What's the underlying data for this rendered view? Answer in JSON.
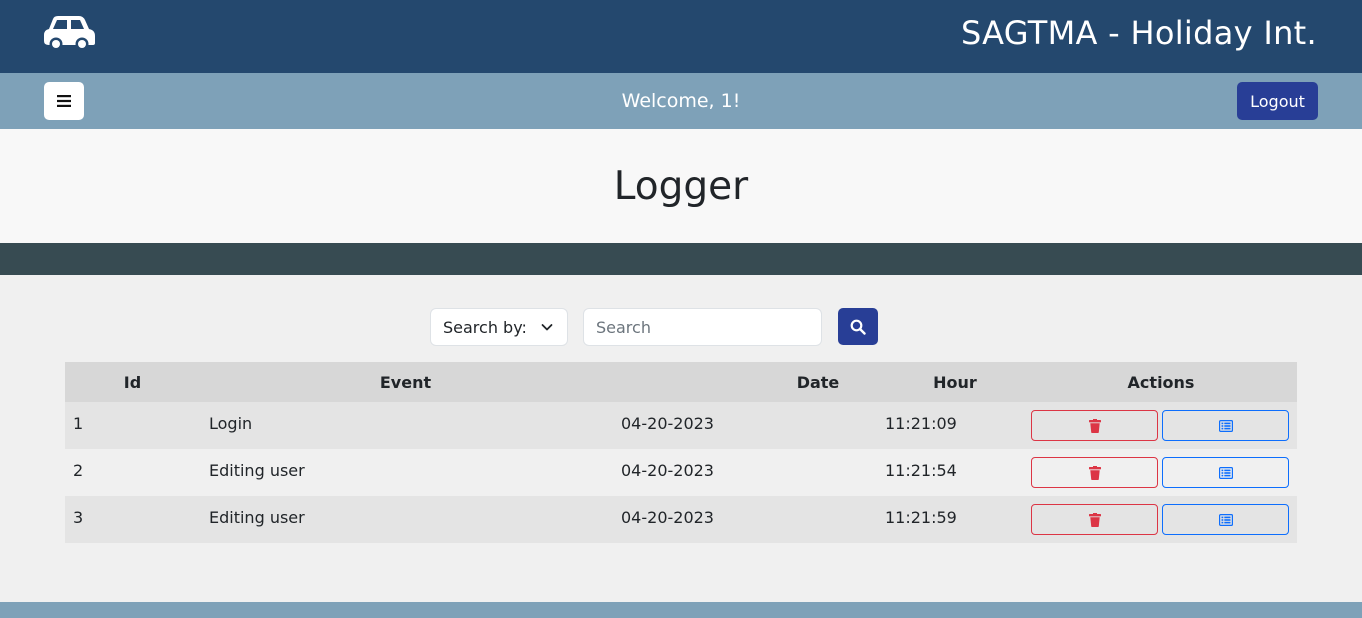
{
  "header": {
    "brand": "SAGTMA - Holiday Int.",
    "logo_icon": "car-icon"
  },
  "subheader": {
    "menu_icon": "hamburger-icon",
    "welcome": "Welcome, 1!",
    "logout_label": "Logout"
  },
  "page": {
    "title": "Logger"
  },
  "search": {
    "select_label": "Search by:",
    "placeholder": "Search",
    "value": "",
    "button_icon": "search-icon"
  },
  "table": {
    "columns": [
      "Id",
      "Event",
      "Date",
      "Hour",
      "Actions"
    ],
    "rows": [
      {
        "id": "1",
        "event": "Login",
        "date": "04-20-2023",
        "hour": "11:21:09"
      },
      {
        "id": "2",
        "event": "Editing user",
        "date": "04-20-2023",
        "hour": "11:21:54"
      },
      {
        "id": "3",
        "event": "Editing user",
        "date": "04-20-2023",
        "hour": "11:21:59"
      }
    ],
    "row_actions": [
      "trash-icon",
      "list-icon"
    ]
  },
  "colors": {
    "topbar": "#24486e",
    "subbar": "#7ea1b8",
    "primary_button": "#283e96",
    "dark_band": "#374b52",
    "danger": "#dc3545",
    "info": "#0d6efd"
  }
}
